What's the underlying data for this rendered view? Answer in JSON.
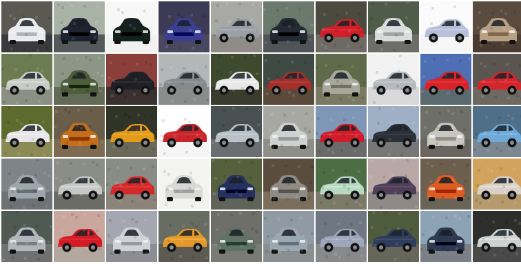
{
  "grid": {
    "rows": 5,
    "cols": 10,
    "subject": "car",
    "tiles": [
      {
        "bg": "#5b5a52",
        "ground": "#3a3a3c",
        "car": "#e9ecf1",
        "view": "front"
      },
      {
        "bg": "#a9b3a5",
        "ground": "#55585a",
        "car": "#1d2330",
        "view": "front"
      },
      {
        "bg": "#f7f7f7",
        "ground": "#f1f1f1",
        "car": "#13221c",
        "view": "front"
      },
      {
        "bg": "#3c3a55",
        "ground": "#4a4860",
        "car": "#3b3f91",
        "view": "front"
      },
      {
        "bg": "#a8a8a4",
        "ground": "#8f8c87",
        "car": "#9aa0a6",
        "view": "side"
      },
      {
        "bg": "#6b7a6d",
        "ground": "#505456",
        "car": "#232a33",
        "view": "front"
      },
      {
        "bg": "#4a4a3f",
        "ground": "#6c6a63",
        "car": "#d2202a",
        "view": "side"
      },
      {
        "bg": "#4f5c49",
        "ground": "#6d6e6a",
        "car": "#dadcdc",
        "view": "front"
      },
      {
        "bg": "#fbfbfb",
        "ground": "#f6f6f6",
        "car": "#b7c0d8",
        "view": "side"
      },
      {
        "bg": "#5a4b3e",
        "ground": "#4a3c31",
        "car": "#b79f84",
        "view": "front"
      },
      {
        "bg": "#6d7b52",
        "ground": "#8b8f84",
        "car": "#c9cbc7",
        "view": "side"
      },
      {
        "bg": "#8c9686",
        "ground": "#636a55",
        "car": "#4d5c3a",
        "view": "front"
      },
      {
        "bg": "#8a3f3a",
        "ground": "#3b3030",
        "car": "#1f2026",
        "view": "side"
      },
      {
        "bg": "#b3b7b8",
        "ground": "#8a8d8c",
        "car": "#858a8b",
        "view": "side"
      },
      {
        "bg": "#3d4a2e",
        "ground": "#3a3d2e",
        "car": "#e8e8e8",
        "view": "side"
      },
      {
        "bg": "#3f4a44",
        "ground": "#5a4a3c",
        "car": "#a3302c",
        "view": "side"
      },
      {
        "bg": "#5f6a4a",
        "ground": "#7a7a62",
        "car": "#a7a79b",
        "view": "front"
      },
      {
        "bg": "#f2f2f2",
        "ground": "#d9d9d9",
        "car": "#b6b9bd",
        "view": "side"
      },
      {
        "bg": "#4e6fb3",
        "ground": "#5a6a6f",
        "car": "#d8232a",
        "view": "side"
      },
      {
        "bg": "#5b5550",
        "ground": "#6d6862",
        "car": "#d2262d",
        "view": "side"
      },
      {
        "bg": "#5e6b2e",
        "ground": "#8c8a55",
        "car": "#e6e6e8",
        "view": "side"
      },
      {
        "bg": "#6a5d49",
        "ground": "#7d6a50",
        "car": "#c46d1a",
        "view": "front"
      },
      {
        "bg": "#2f3427",
        "ground": "#6b6a59",
        "car": "#e39b1b",
        "view": "side"
      },
      {
        "bg": "#ffffff",
        "ground": "#f5f5f5",
        "car": "#c9262c",
        "view": "side"
      },
      {
        "bg": "#495052",
        "ground": "#6a6e70",
        "car": "#b9c1c7",
        "view": "side"
      },
      {
        "bg": "#a8a8a2",
        "ground": "#8e8e88",
        "car": "#cfd1d1",
        "view": "front"
      },
      {
        "bg": "#7e97b7",
        "ground": "#6a6a6a",
        "car": "#cf1d2c",
        "view": "side"
      },
      {
        "bg": "#9fb0c4",
        "ground": "#777777",
        "car": "#2a3038",
        "view": "side"
      },
      {
        "bg": "#6f6f6a",
        "ground": "#6a6560",
        "car": "#c9c7c2",
        "view": "front"
      },
      {
        "bg": "#4f6e87",
        "ground": "#7a8790",
        "car": "#6ea9d8",
        "view": "side"
      },
      {
        "bg": "#7d8589",
        "ground": "#6f7275",
        "car": "#9ea6ad",
        "view": "front"
      },
      {
        "bg": "#8a8e86",
        "ground": "#6a6c65",
        "car": "#c6c8c6",
        "view": "side"
      },
      {
        "bg": "#8a8d86",
        "ground": "#8c8478",
        "car": "#d22a2a",
        "view": "side"
      },
      {
        "bg": "#f3f3f1",
        "ground": "#f2f2f0",
        "car": "#d8d9d7",
        "view": "front"
      },
      {
        "bg": "#57603d",
        "ground": "#606357",
        "car": "#24305e",
        "view": "front"
      },
      {
        "bg": "#5a4d3d",
        "ground": "#7b6f5c",
        "car": "#8f8b84",
        "view": "front"
      },
      {
        "bg": "#4d6d44",
        "ground": "#7b7a68",
        "car": "#b7d8c1",
        "view": "side"
      },
      {
        "bg": "#b9a8a6",
        "ground": "#8f8a86",
        "car": "#4f3f5a",
        "view": "side"
      },
      {
        "bg": "#6d5f4e",
        "ground": "#6a6457",
        "car": "#dd5c22",
        "view": "front"
      },
      {
        "bg": "#d1a35c",
        "ground": "#b49a6c",
        "car": "#d9d1c7",
        "view": "side"
      },
      {
        "bg": "#4f5a53",
        "ground": "#6f7170",
        "car": "#b1b6bb",
        "view": "front"
      },
      {
        "bg": "#caa79d",
        "ground": "#b3a8a0",
        "car": "#d21b25",
        "view": "side"
      },
      {
        "bg": "#a5a7b0",
        "ground": "#8d8e93",
        "car": "#cfd2d6",
        "view": "front"
      },
      {
        "bg": "#686c62",
        "ground": "#5c5a51",
        "car": "#e49a2b",
        "view": "side"
      },
      {
        "bg": "#6e6f68",
        "ground": "#7a7b74",
        "car": "#5f7266",
        "view": "front"
      },
      {
        "bg": "#8f9aa3",
        "ground": "#8a8f91",
        "car": "#9aa8b1",
        "view": "front"
      },
      {
        "bg": "#6e7782",
        "ground": "#87898a",
        "car": "#9ea6b9",
        "view": "side"
      },
      {
        "bg": "#4f5b3d",
        "ground": "#66665a",
        "car": "#2f3d5c",
        "view": "side"
      },
      {
        "bg": "#8ca3b5",
        "ground": "#7b7f86",
        "car": "#2d3b52",
        "view": "front"
      },
      {
        "bg": "#2d2d2b",
        "ground": "#4a4a48",
        "car": "#cfd2d3",
        "view": "side"
      }
    ]
  }
}
